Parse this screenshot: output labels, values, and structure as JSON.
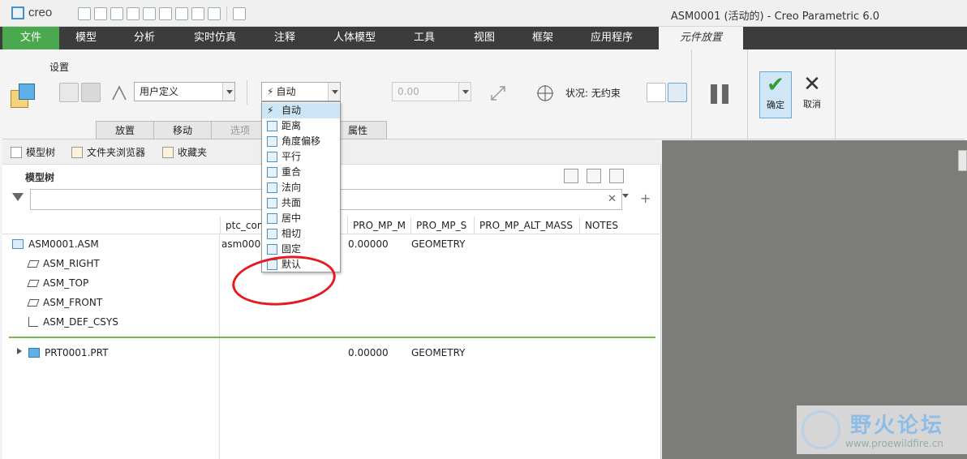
{
  "app": {
    "logo_text": "creo",
    "window_title": "ASM0001 (活动的) - Creo Parametric 6.0"
  },
  "menu": {
    "items": [
      "文件",
      "模型",
      "分析",
      "实时仿真",
      "注释",
      "人体模型",
      "工具",
      "视图",
      "框架",
      "应用程序",
      "元件放置"
    ]
  },
  "ribbon": {
    "setup_label": "设置",
    "constraint_set": "用户定义",
    "constraint_type": "自动",
    "offset_value": "0.00",
    "status": "状况: 无约束",
    "ok_label": "确定",
    "cancel_label": "取消",
    "tabs": [
      "放置",
      "移动",
      "选项",
      "属性"
    ]
  },
  "dropdown": {
    "items": [
      {
        "label": "自动",
        "icon": "lightning-icon"
      },
      {
        "label": "距离",
        "icon": "distance-icon"
      },
      {
        "label": "角度偏移",
        "icon": "angle-offset-icon"
      },
      {
        "label": "平行",
        "icon": "parallel-icon"
      },
      {
        "label": "重合",
        "icon": "coincident-icon"
      },
      {
        "label": "法向",
        "icon": "normal-icon"
      },
      {
        "label": "共面",
        "icon": "coplanar-icon"
      },
      {
        "label": "居中",
        "icon": "centered-icon"
      },
      {
        "label": "相切",
        "icon": "tangent-icon"
      },
      {
        "label": "固定",
        "icon": "fixed-icon"
      },
      {
        "label": "默认",
        "icon": "default-icon"
      }
    ]
  },
  "panel": {
    "tabs": [
      "模型树",
      "文件夹浏览器",
      "收藏夹"
    ],
    "tree_title": "模型树",
    "filter_placeholder": ""
  },
  "columns": [
    "ptc_common_name",
    "PRO_MP_M",
    "PRO_MP_S",
    "PRO_MP_ALT_MASS",
    "NOTES"
  ],
  "tree": [
    {
      "name": "ASM0001.ASM",
      "icon": "assembly-icon",
      "common": "asm0001",
      "mass": "0.00000",
      "source": "GEOMETRY"
    },
    {
      "name": "ASM_RIGHT",
      "icon": "datum-plane-icon",
      "common": "",
      "mass": "",
      "source": ""
    },
    {
      "name": "ASM_TOP",
      "icon": "datum-plane-icon",
      "common": "",
      "mass": "",
      "source": ""
    },
    {
      "name": "ASM_FRONT",
      "icon": "datum-plane-icon",
      "common": "",
      "mass": "",
      "source": ""
    },
    {
      "name": "ASM_DEF_CSYS",
      "icon": "coordinate-system-icon",
      "common": "",
      "mass": "",
      "source": ""
    },
    {
      "name": "PRT0001.PRT",
      "icon": "part-icon",
      "common": "",
      "mass": "0.00000",
      "source": "GEOMETRY"
    }
  ],
  "watermark": {
    "title": "野火论坛",
    "url": "www.proewildfire.cn"
  },
  "colors": {
    "menu_bg": "#3c3c3c",
    "file_menu": "#4aa84e",
    "accent": "#4b8fc7",
    "annotation": "#e6191e"
  }
}
